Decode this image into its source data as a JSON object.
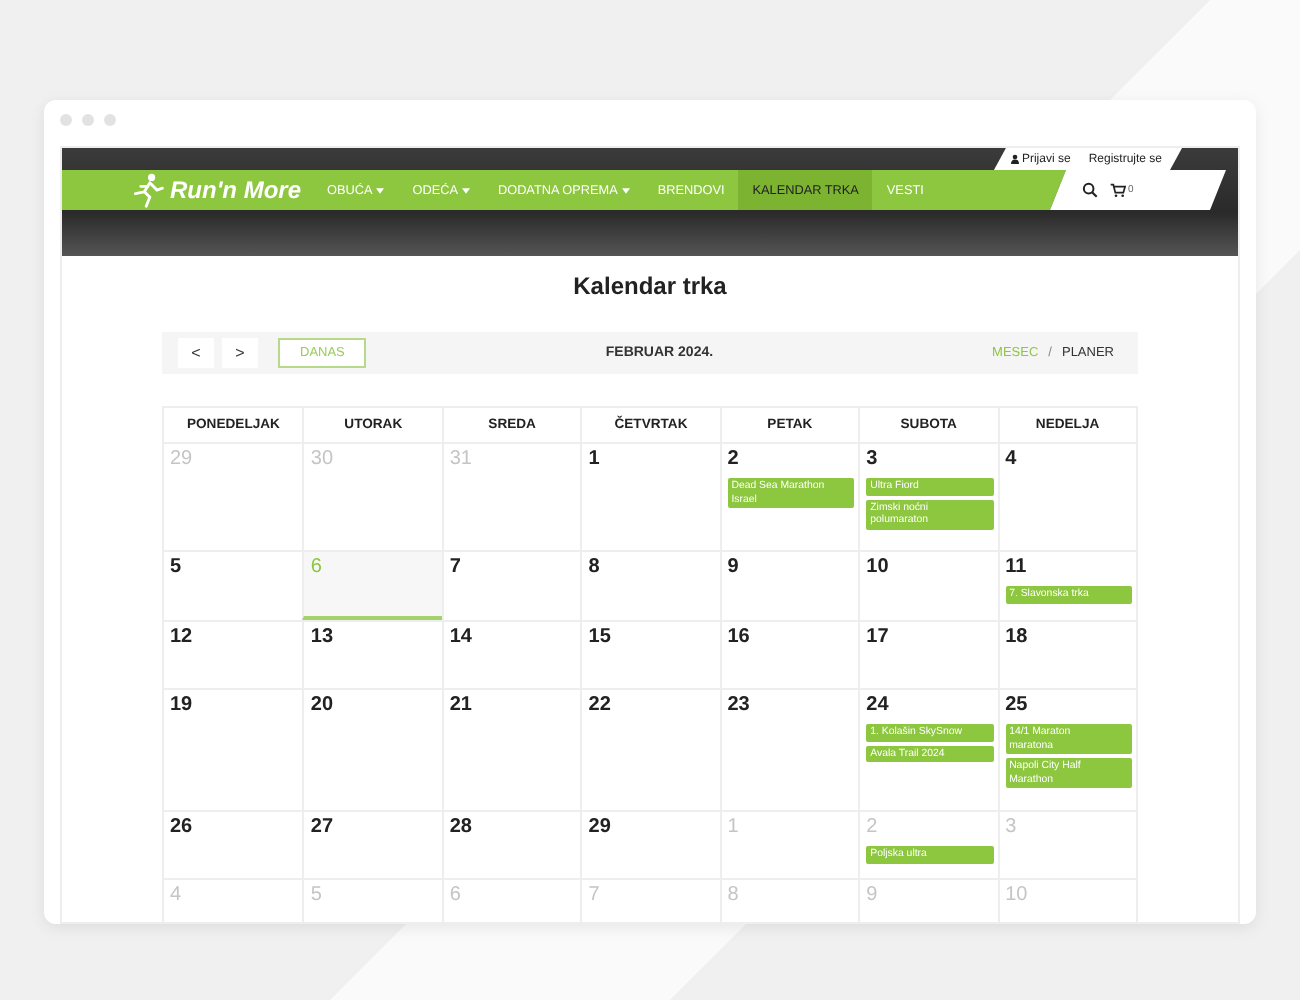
{
  "header": {
    "account": [
      {
        "label": "Prijavi se",
        "kind": "login"
      },
      {
        "label": "Registrujte se",
        "kind": "register"
      }
    ],
    "logo": "Run'n More",
    "nav": [
      {
        "label": "OBUĆA",
        "dropdown": true,
        "selected": false
      },
      {
        "label": "ODEĆA",
        "dropdown": true,
        "selected": false
      },
      {
        "label": "DODATNA OPREMA",
        "dropdown": true,
        "selected": false
      },
      {
        "label": "BRENDOVI",
        "dropdown": false,
        "selected": false
      },
      {
        "label": "KALENDAR TRKA",
        "dropdown": false,
        "selected": true
      },
      {
        "label": "VESTI",
        "dropdown": false,
        "selected": false
      }
    ],
    "cart_count": "0"
  },
  "title": "Kalendar trka",
  "toolbar": {
    "prev": "<",
    "next": ">",
    "today": "DANAS",
    "month": "FEBRUAR 2024.",
    "views": [
      {
        "label": "MESEC",
        "selected": true
      },
      {
        "label": "PLANER",
        "selected": false
      }
    ],
    "separator": "/"
  },
  "weekdays": [
    "PONEDELJAK",
    "UTORAK",
    "SREDA",
    "ČETVRTAK",
    "PETAK",
    "SUBOTA",
    "NEDELJA"
  ],
  "weeks": [
    {
      "days": [
        {
          "day": "29",
          "outside": true,
          "today": false
        },
        {
          "day": "30",
          "outside": true,
          "today": false
        },
        {
          "day": "31",
          "outside": true,
          "today": false
        },
        {
          "day": "1",
          "outside": false,
          "today": false
        },
        {
          "day": "2",
          "outside": false,
          "today": false,
          "events": [
            "Dead Sea Marathon Israel"
          ]
        },
        {
          "day": "3",
          "outside": false,
          "today": false,
          "events": [
            "Ultra Fiord",
            "Zimski noćni polumaraton"
          ]
        },
        {
          "day": "4",
          "outside": false,
          "today": false
        }
      ]
    },
    {
      "days": [
        {
          "day": "5",
          "outside": false,
          "today": false
        },
        {
          "day": "6",
          "outside": false,
          "today": true
        },
        {
          "day": "7",
          "outside": false,
          "today": false
        },
        {
          "day": "8",
          "outside": false,
          "today": false
        },
        {
          "day": "9",
          "outside": false,
          "today": false
        },
        {
          "day": "10",
          "outside": false,
          "today": false
        },
        {
          "day": "11",
          "outside": false,
          "today": false,
          "events": [
            "7. Slavonska trka"
          ]
        }
      ]
    },
    {
      "days": [
        {
          "day": "12",
          "outside": false,
          "today": false
        },
        {
          "day": "13",
          "outside": false,
          "today": false
        },
        {
          "day": "14",
          "outside": false,
          "today": false
        },
        {
          "day": "15",
          "outside": false,
          "today": false
        },
        {
          "day": "16",
          "outside": false,
          "today": false
        },
        {
          "day": "17",
          "outside": false,
          "today": false
        },
        {
          "day": "18",
          "outside": false,
          "today": false
        }
      ]
    },
    {
      "days": [
        {
          "day": "19",
          "outside": false,
          "today": false
        },
        {
          "day": "20",
          "outside": false,
          "today": false
        },
        {
          "day": "21",
          "outside": false,
          "today": false
        },
        {
          "day": "22",
          "outside": false,
          "today": false
        },
        {
          "day": "23",
          "outside": false,
          "today": false
        },
        {
          "day": "24",
          "outside": false,
          "today": false,
          "events": [
            "1. Kolašin SkySnow",
            "Avala Trail 2024"
          ]
        },
        {
          "day": "25",
          "outside": false,
          "today": false,
          "events": [
            "14/1 Maraton maratona",
            "Napoli City Half Marathon"
          ]
        }
      ]
    },
    {
      "days": [
        {
          "day": "26",
          "outside": false,
          "today": false
        },
        {
          "day": "27",
          "outside": false,
          "today": false
        },
        {
          "day": "28",
          "outside": false,
          "today": false
        },
        {
          "day": "29",
          "outside": false,
          "today": false
        },
        {
          "day": "1",
          "outside": true,
          "today": false
        },
        {
          "day": "2",
          "outside": true,
          "today": false,
          "events": [
            "Poljska ultra"
          ]
        },
        {
          "day": "3",
          "outside": true,
          "today": false
        }
      ]
    },
    {
      "days": [
        {
          "day": "4",
          "outside": true,
          "today": false
        },
        {
          "day": "5",
          "outside": true,
          "today": false
        },
        {
          "day": "6",
          "outside": true,
          "today": false
        },
        {
          "day": "7",
          "outside": true,
          "today": false
        },
        {
          "day": "8",
          "outside": true,
          "today": false
        },
        {
          "day": "9",
          "outside": true,
          "today": false
        },
        {
          "day": "10",
          "outside": true,
          "today": false
        }
      ]
    }
  ]
}
